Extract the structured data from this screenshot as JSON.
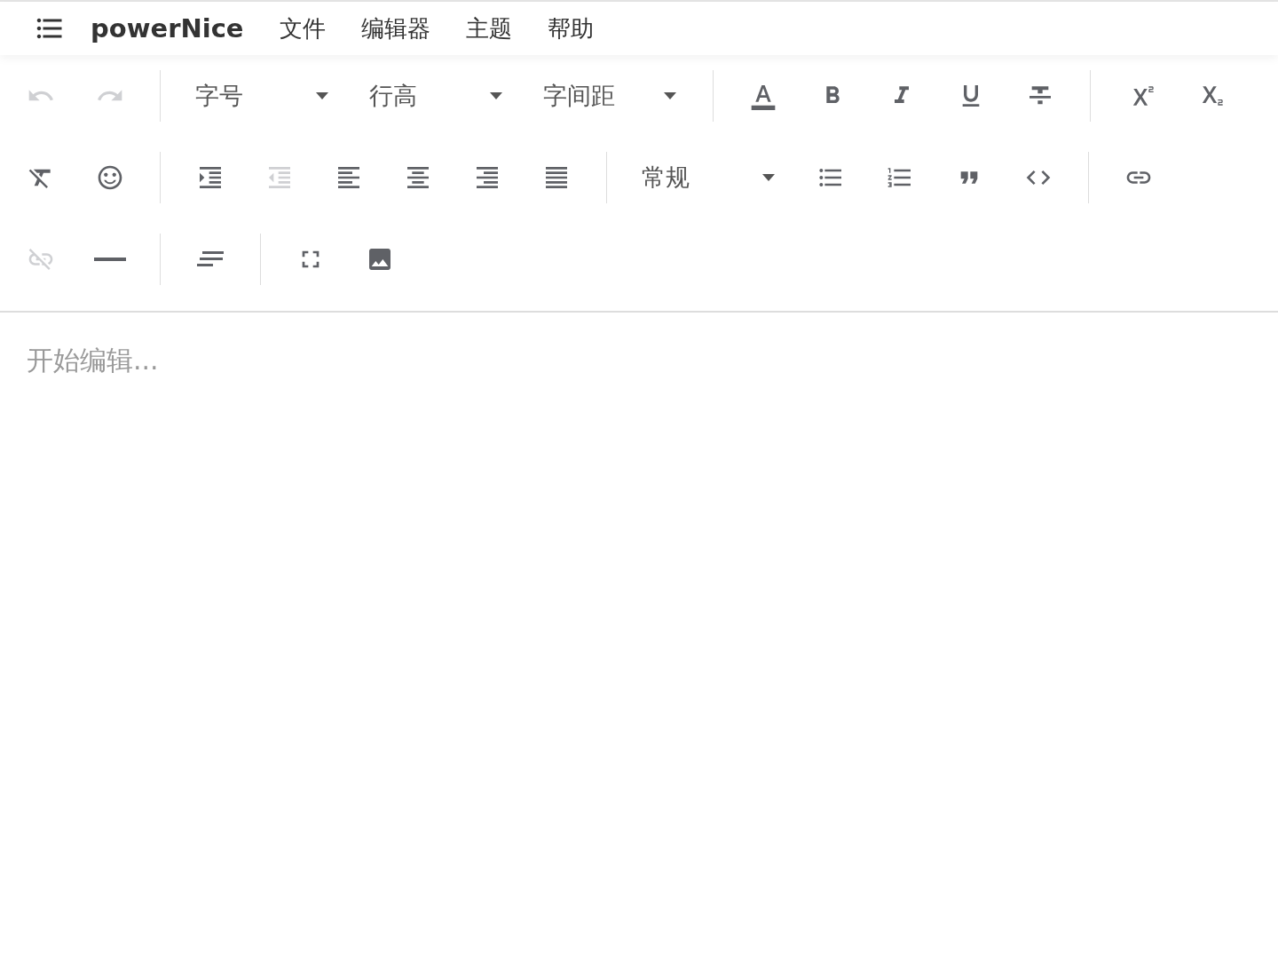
{
  "menubar": {
    "title": "powerNice",
    "menus": [
      "文件",
      "编辑器",
      "主题",
      "帮助"
    ]
  },
  "toolbar": {
    "rows": [
      [
        [
          {
            "kind": "button",
            "disabled": true
          },
          {
            "kind": "button",
            "disabled": true
          }
        ],
        [
          {
            "kind": "select",
            "label": "字号"
          },
          {
            "kind": "select",
            "label": "行高"
          },
          {
            "kind": "select",
            "label": "字间距"
          }
        ],
        [
          {
            "kind": "button",
            "disabled": false
          },
          {
            "kind": "button",
            "disabled": false
          },
          {
            "kind": "button",
            "disabled": false
          },
          {
            "kind": "button",
            "disabled": false
          },
          {
            "kind": "button",
            "disabled": false
          }
        ],
        [
          {
            "kind": "button",
            "disabled": false
          },
          {
            "kind": "button",
            "disabled": false
          }
        ]
      ],
      [
        [
          {
            "kind": "button",
            "disabled": false
          },
          {
            "kind": "button",
            "disabled": false
          }
        ],
        [
          {
            "kind": "button",
            "disabled": false
          },
          {
            "kind": "button",
            "disabled": true
          },
          {
            "kind": "button",
            "disabled": false
          },
          {
            "kind": "button",
            "disabled": false
          },
          {
            "kind": "button",
            "disabled": false
          },
          {
            "kind": "button",
            "disabled": false
          }
        ],
        [
          {
            "kind": "select",
            "label": "常规"
          },
          {
            "kind": "button",
            "disabled": false
          },
          {
            "kind": "button",
            "disabled": false
          },
          {
            "kind": "button",
            "disabled": false
          },
          {
            "kind": "button",
            "disabled": false
          }
        ],
        [
          {
            "kind": "button",
            "disabled": false
          }
        ]
      ],
      [
        [
          {
            "kind": "button",
            "disabled": true
          },
          {
            "kind": "button",
            "disabled": false
          }
        ],
        [
          {
            "kind": "button",
            "disabled": false
          }
        ],
        [
          {
            "kind": "button",
            "disabled": false
          },
          {
            "kind": "button",
            "disabled": false
          }
        ]
      ]
    ]
  },
  "editor": {
    "placeholder": "开始编辑..."
  }
}
